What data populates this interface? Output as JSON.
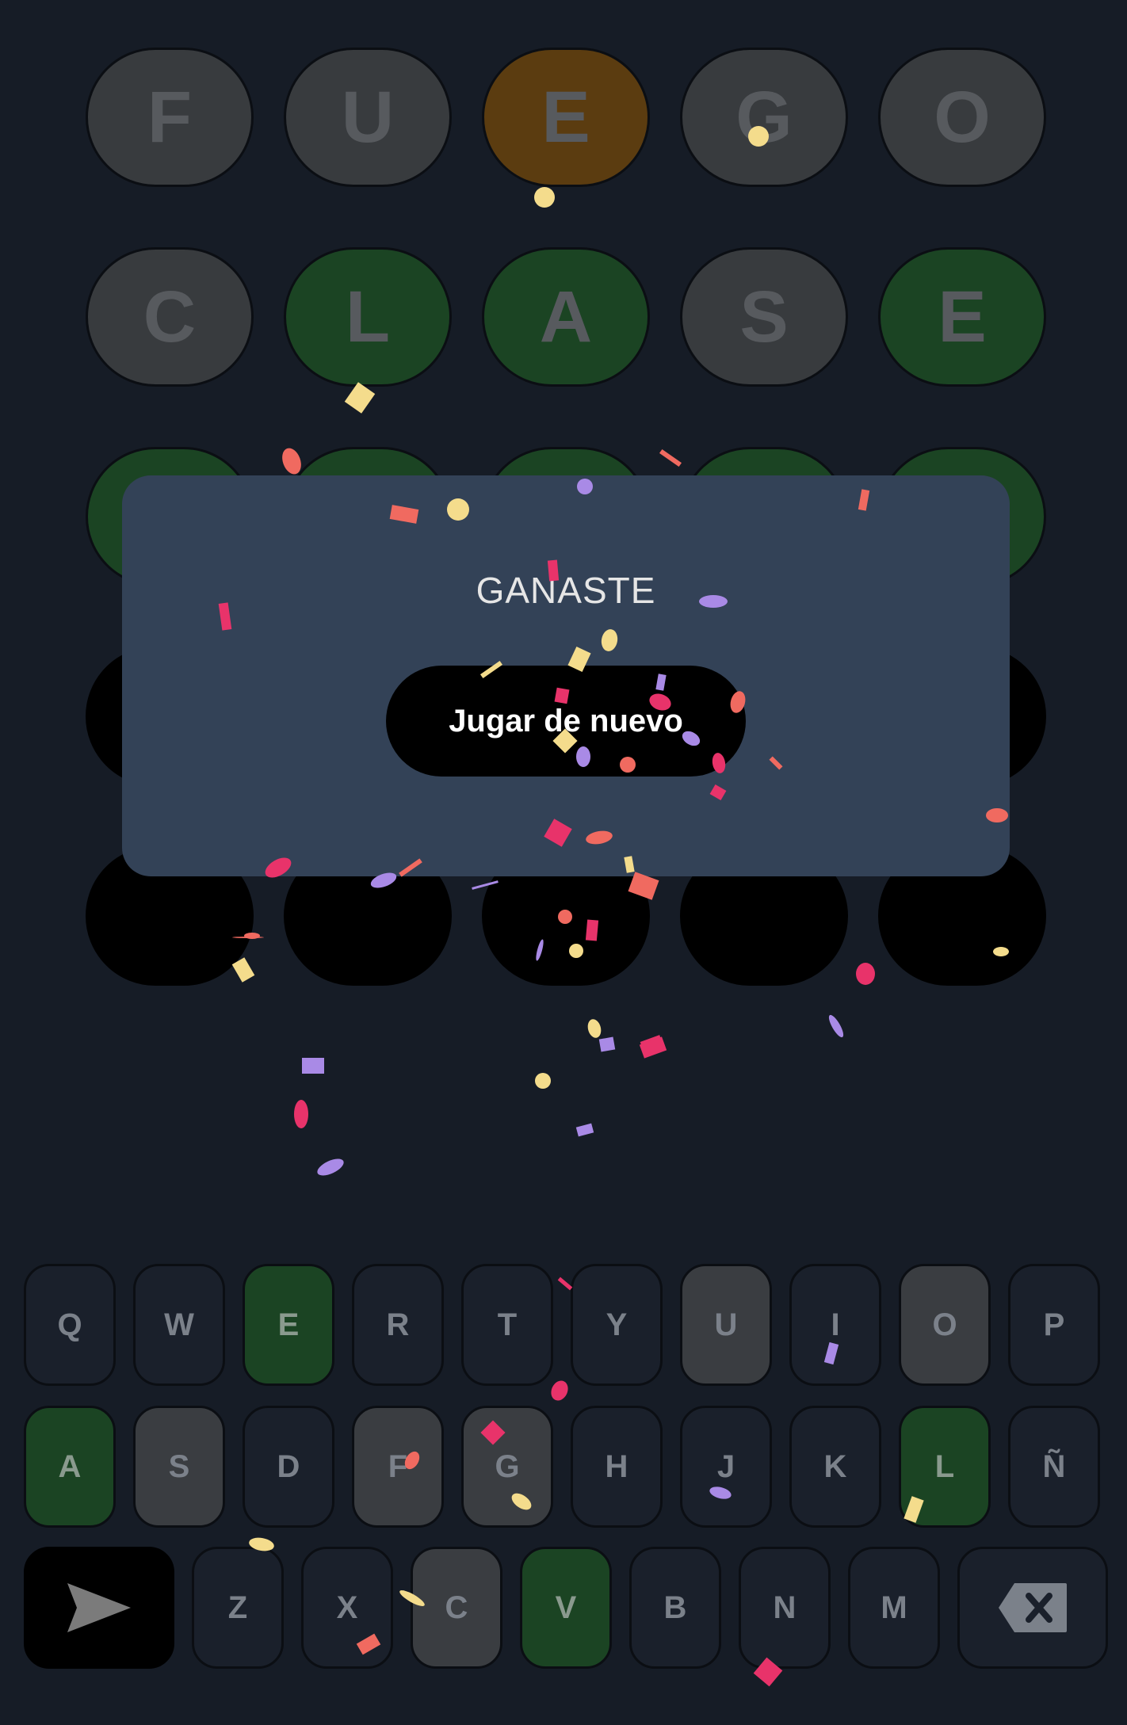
{
  "board": {
    "rows": [
      [
        {
          "letter": "F",
          "state": "absent"
        },
        {
          "letter": "U",
          "state": "absent"
        },
        {
          "letter": "E",
          "state": "present"
        },
        {
          "letter": "G",
          "state": "absent"
        },
        {
          "letter": "O",
          "state": "absent"
        }
      ],
      [
        {
          "letter": "C",
          "state": "absent"
        },
        {
          "letter": "L",
          "state": "correct"
        },
        {
          "letter": "A",
          "state": "correct"
        },
        {
          "letter": "S",
          "state": "absent"
        },
        {
          "letter": "E",
          "state": "correct"
        }
      ],
      [
        {
          "letter": "",
          "state": "correct"
        },
        {
          "letter": "",
          "state": "correct"
        },
        {
          "letter": "",
          "state": "correct"
        },
        {
          "letter": "",
          "state": "correct"
        },
        {
          "letter": "",
          "state": "correct"
        }
      ],
      [
        {
          "letter": "",
          "state": "empty"
        },
        {
          "letter": "",
          "state": "empty"
        },
        {
          "letter": "",
          "state": "empty"
        },
        {
          "letter": "",
          "state": "empty"
        },
        {
          "letter": "",
          "state": "empty"
        }
      ],
      [
        {
          "letter": "",
          "state": "empty"
        },
        {
          "letter": "",
          "state": "empty"
        },
        {
          "letter": "",
          "state": "empty"
        },
        {
          "letter": "",
          "state": "empty"
        },
        {
          "letter": "",
          "state": "empty"
        }
      ]
    ]
  },
  "modal": {
    "title": "GANASTE",
    "button_label": "Jugar de nuevo"
  },
  "keyboard": {
    "row1": [
      {
        "label": "Q",
        "state": "default"
      },
      {
        "label": "W",
        "state": "default"
      },
      {
        "label": "E",
        "state": "correct"
      },
      {
        "label": "R",
        "state": "default"
      },
      {
        "label": "T",
        "state": "default"
      },
      {
        "label": "Y",
        "state": "default"
      },
      {
        "label": "U",
        "state": "absent"
      },
      {
        "label": "I",
        "state": "default"
      },
      {
        "label": "O",
        "state": "absent"
      },
      {
        "label": "P",
        "state": "default"
      }
    ],
    "row2": [
      {
        "label": "A",
        "state": "correct"
      },
      {
        "label": "S",
        "state": "absent"
      },
      {
        "label": "D",
        "state": "default"
      },
      {
        "label": "F",
        "state": "absent"
      },
      {
        "label": "G",
        "state": "absent"
      },
      {
        "label": "H",
        "state": "default"
      },
      {
        "label": "J",
        "state": "default"
      },
      {
        "label": "K",
        "state": "default"
      },
      {
        "label": "L",
        "state": "correct"
      },
      {
        "label": "Ñ",
        "state": "default"
      }
    ],
    "row3": [
      {
        "label": "Z",
        "state": "default"
      },
      {
        "label": "X",
        "state": "default"
      },
      {
        "label": "C",
        "state": "absent"
      },
      {
        "label": "V",
        "state": "correct"
      },
      {
        "label": "B",
        "state": "default"
      },
      {
        "label": "N",
        "state": "default"
      },
      {
        "label": "M",
        "state": "default"
      }
    ],
    "send_icon": "send-icon",
    "backspace_icon": "backspace-icon"
  },
  "colors": {
    "background": "#161c26",
    "absent": "#383b3e",
    "present": "#5b3c10",
    "correct": "#1b4423",
    "modal": "#334257",
    "confetti": [
      "#f06a60",
      "#e8336a",
      "#f4dc8c",
      "#a98ae6"
    ]
  }
}
